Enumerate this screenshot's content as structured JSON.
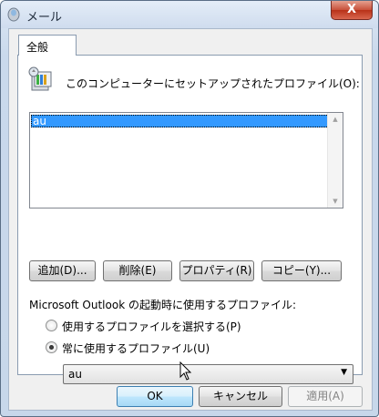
{
  "window": {
    "title": "メール",
    "close_glyph": "X"
  },
  "tabs": [
    {
      "label": "全般",
      "selected": true
    }
  ],
  "profiles": {
    "heading": "このコンピューターにセットアップされたプロファイル(O):",
    "items": [
      {
        "label": "au",
        "selected": true
      }
    ]
  },
  "actions": {
    "add_label": "追加(D)...",
    "delete_label": "削除(E)",
    "properties_label": "プロパティ(R)",
    "copy_label": "コピー(Y)..."
  },
  "startup": {
    "label": "Microsoft Outlook の起動時に使用するプロファイル:",
    "option_prompt": "使用するプロファイルを選択する(P)",
    "option_always": "常に使用するプロファイル(U)",
    "selected_option": "always",
    "profile_value": "au"
  },
  "footer": {
    "ok_label": "OK",
    "cancel_label": "キャンセル",
    "apply_label": "適用(A)"
  },
  "colors": {
    "selection": "#3399ff",
    "close_button": "#c8503a"
  }
}
